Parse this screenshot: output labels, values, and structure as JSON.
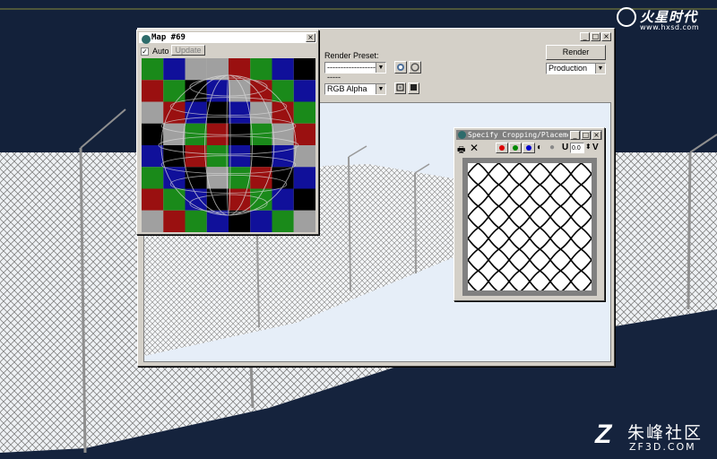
{
  "render_window": {
    "render_preset_label": "Render Preset:",
    "render_preset_value": "--------------------------",
    "render_button": "Render",
    "mode_value": "Production",
    "channel_value": "RGB Alpha",
    "min_btn": "_",
    "max_btn": "□",
    "close_btn": "×"
  },
  "map_window": {
    "title": "Map #69",
    "auto_label": "Auto",
    "auto_checked": "✓",
    "update_label": "Update",
    "close_btn": "×",
    "checker_colors": [
      [
        "#1a8a1a",
        "#10109a",
        "#a0a0a0",
        "#a0a0a0",
        "#9a1010",
        "#1a8a1a",
        "#10109a",
        "#000000"
      ],
      [
        "#9a1010",
        "#1a8a1a",
        "#000000",
        "#10109a",
        "#a0a0a0",
        "#9a1010",
        "#1a8a1a",
        "#10109a"
      ],
      [
        "#a0a0a0",
        "#9a1010",
        "#10109a",
        "#000000",
        "#10109a",
        "#a0a0a0",
        "#9a1010",
        "#1a8a1a"
      ],
      [
        "#000000",
        "#a0a0a0",
        "#1a8a1a",
        "#9a1010",
        "#000000",
        "#1a8a1a",
        "#a0a0a0",
        "#9a1010"
      ],
      [
        "#10109a",
        "#000000",
        "#9a1010",
        "#1a8a1a",
        "#10109a",
        "#000000",
        "#10109a",
        "#a0a0a0"
      ],
      [
        "#1a8a1a",
        "#10109a",
        "#000000",
        "#a0a0a0",
        "#1a8a1a",
        "#9a1010",
        "#000000",
        "#10109a"
      ],
      [
        "#9a1010",
        "#1a8a1a",
        "#10109a",
        "#000000",
        "#9a1010",
        "#1a8a1a",
        "#10109a",
        "#000000"
      ],
      [
        "#a0a0a0",
        "#9a1010",
        "#1a8a1a",
        "#10109a",
        "#000000",
        "#10109a",
        "#1a8a1a",
        "#a0a0a0"
      ]
    ]
  },
  "crop_window": {
    "title": "Specify Cropping/Placement",
    "u_label": "U",
    "u_value": "0.0",
    "v_label": "V",
    "min_btn": "_",
    "max_btn": "□",
    "close_btn": "×"
  },
  "watermarks": {
    "top_brand": "火星时代",
    "top_url": "www.hxsd.com",
    "bottom_brand": "朱峰社区",
    "bottom_url": "ZF3D.COM"
  },
  "colors": {
    "background": "#13213a",
    "ground": "#eef3fa",
    "window_gray": "#d4d0c8"
  }
}
